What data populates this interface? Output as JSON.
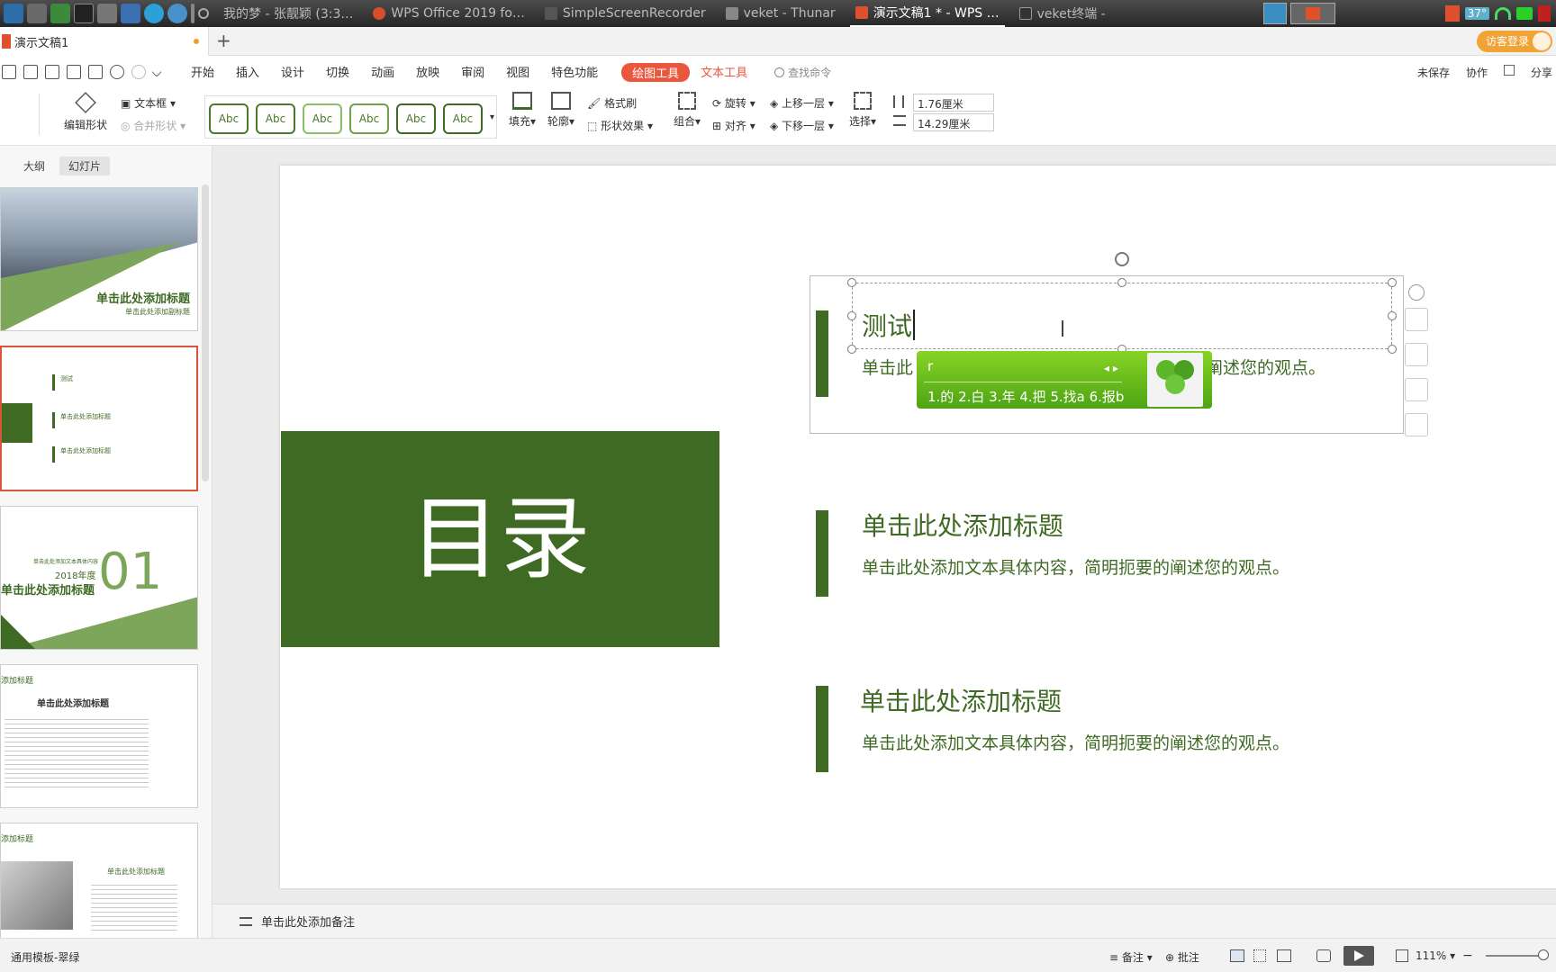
{
  "taskbar": {
    "tasks": [
      {
        "label": "我的梦 - 张靓颖 (3:3…"
      },
      {
        "label": "WPS Office 2019 fo…"
      },
      {
        "label": "SimpleScreenRecorder"
      },
      {
        "label": "veket - Thunar"
      },
      {
        "label": "演示文稿1 * - WPS …",
        "active": true
      },
      {
        "label": "veket终端 -"
      }
    ],
    "temp": "37°"
  },
  "doc_tab": {
    "title": "演示文稿1",
    "new_tab": "+"
  },
  "guest_login": "访客登录",
  "menu": {
    "items": [
      "开始",
      "插入",
      "设计",
      "切换",
      "动画",
      "放映",
      "审阅",
      "视图",
      "特色功能"
    ],
    "drawing_tools": "绘图工具",
    "text_tools": "文本工具",
    "search": "查找命令",
    "unsaved": "未保存",
    "collab": "协作",
    "share": "分享"
  },
  "ribbon": {
    "edit_shape": "编辑形状",
    "text_box": "文本框",
    "merge_shape": "合并形状",
    "styles": [
      "Abc",
      "Abc",
      "Abc",
      "Abc",
      "Abc",
      "Abc"
    ],
    "fill": "填充",
    "outline": "轮廓",
    "format_painter": "格式刷",
    "shape_effect": "形状效果",
    "group": "组合",
    "rotate": "旋转",
    "align": "对齐",
    "bring_forward": "上移一层",
    "send_backward": "下移一层",
    "select": "选择",
    "height": "1.76厘米",
    "width": "14.29厘米"
  },
  "sidebar": {
    "tab_outline": "大纲",
    "tab_slides": "幻灯片",
    "thumb1": {
      "title": "单击此处添加标题",
      "sub": "单击此处添加副标题"
    },
    "thumb2": {
      "items": [
        "测试",
        "单击此处添加标题",
        "单击此处添加标题"
      ]
    },
    "thumb3": {
      "num": "01",
      "year": "2018年度",
      "title": "单击此处添加标题",
      "sub": "单击此处添加文本具体内容"
    },
    "thumb4": {
      "head": "添加标题",
      "title": "单击此处添加标题"
    },
    "thumb5": {
      "head": "添加标题",
      "title": "单击此处添加标题"
    }
  },
  "slide": {
    "toc": "目录",
    "items": [
      {
        "title": "测试",
        "desc": "单击此处添加文本具体内容，简明扼要的阐述您的观点。"
      },
      {
        "title": "单击此处添加标题",
        "desc": "单击此处添加文本具体内容，简明扼要的阐述您的观点。"
      },
      {
        "title": "单击此处添加标题",
        "desc": "单击此处添加文本具体内容，简明扼要的阐述您的观点。"
      }
    ],
    "desc1_visible": [
      "单击此",
      "的阐述您的观点。"
    ]
  },
  "ime": {
    "input": "r",
    "candidates": "1.的 2.白 3.年 4.把 5.找a 6.报b"
  },
  "notes_placeholder": "单击此处添加备注",
  "status": {
    "template": "通用模板-翠绿",
    "notes": "备注",
    "comments": "批注",
    "zoom": "111%"
  },
  "colors": {
    "green": "#3e6a23",
    "accent": "#e9573f"
  }
}
